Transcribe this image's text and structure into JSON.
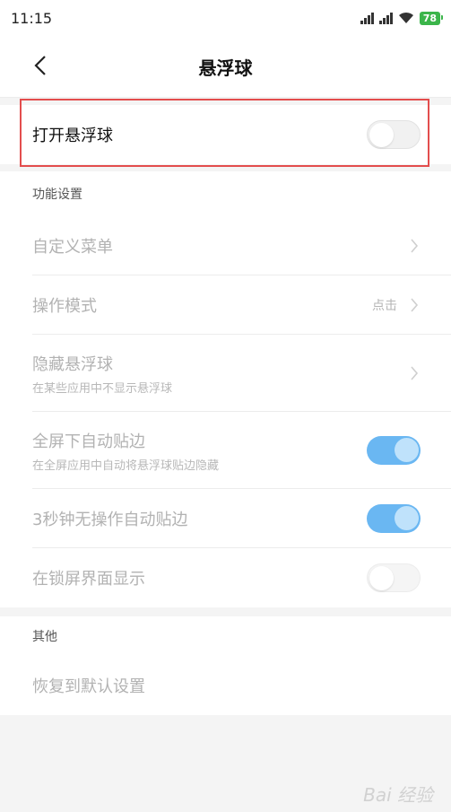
{
  "status_bar": {
    "time": "11:15",
    "battery": "78",
    "battery_color": "#3bb54a"
  },
  "header": {
    "title": "悬浮球",
    "back_icon": "chevron-left-icon"
  },
  "main_toggle": {
    "label": "打开悬浮球",
    "state": "off",
    "highlight_color": "#e34d4d"
  },
  "sections": {
    "function": {
      "title": "功能设置",
      "items": [
        {
          "label": "自定义菜单",
          "type": "link"
        },
        {
          "label": "操作模式",
          "value": "点击",
          "type": "link"
        },
        {
          "label": "隐藏悬浮球",
          "sublabel": "在某些应用中不显示悬浮球",
          "type": "link"
        },
        {
          "label": "全屏下自动贴边",
          "sublabel": "在全屏应用中自动将悬浮球贴边隐藏",
          "type": "toggle",
          "state": "on"
        },
        {
          "label": "3秒钟无操作自动贴边",
          "type": "toggle",
          "state": "on"
        },
        {
          "label": "在锁屏界面显示",
          "type": "toggle",
          "state": "off"
        }
      ]
    },
    "other": {
      "title": "其他",
      "items": [
        {
          "label": "恢复到默认设置",
          "type": "link"
        }
      ]
    }
  },
  "colors": {
    "toggle_on": "#6ab7f2",
    "disabled_text": "#b2b2b2"
  },
  "watermark": "Bai 经验"
}
